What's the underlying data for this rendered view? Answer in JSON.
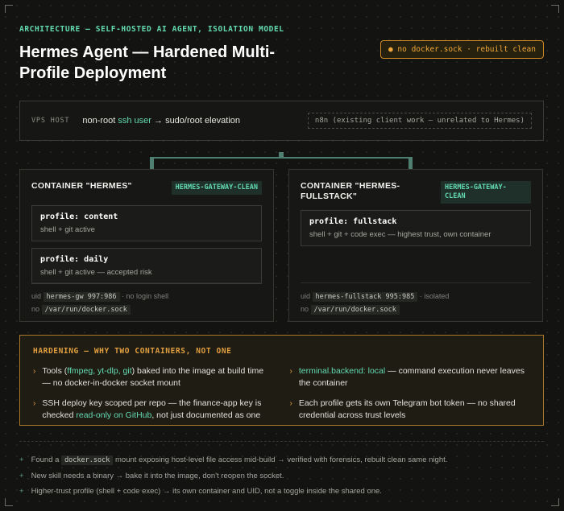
{
  "header": {
    "eyebrow": "ARCHITECTURE — SELF-HOSTED AI AGENT, ISOLATION MODEL",
    "title": "Hermes Agent — Hardened Multi-Profile Deployment",
    "badge": "no docker.sock · rebuilt clean"
  },
  "vps": {
    "label": "VPS HOST",
    "text_prefix": "non-root ",
    "text_highlight": "ssh user",
    "text_suffix": " → sudo/root elevation",
    "n8n": "n8n (existing client work — unrelated to Hermes)"
  },
  "containers": {
    "left": {
      "title": "CONTAINER \"HERMES\"",
      "tag": "HERMES-GATEWAY-CLEAN",
      "profiles": [
        {
          "name": "profile: content",
          "desc": "shell + git active"
        },
        {
          "name": "profile: daily",
          "desc": "shell + git active — accepted risk"
        }
      ],
      "uid_prefix": "uid",
      "uid_code": "hermes-gw 997:986",
      "uid_suffix": "· no login shell",
      "sock_prefix": "no",
      "sock_code": "/var/run/docker.sock"
    },
    "right": {
      "title": "CONTAINER \"HERMES-FULLSTACK\"",
      "tag": "HERMES-GATEWAY-CLEAN",
      "profiles": [
        {
          "name": "profile: fullstack",
          "desc": "shell + git + code exec — highest trust, own container"
        }
      ],
      "uid_prefix": "uid",
      "uid_code": "hermes-fullstack 995:985",
      "uid_suffix": "· isolated",
      "sock_prefix": "no",
      "sock_code": "/var/run/docker.sock"
    }
  },
  "hardening": {
    "title": "HARDENING — WHY TWO CONTAINERS, NOT ONE",
    "item1": {
      "a": "Tools (",
      "hl": "ffmpeg, yt-dlp, git",
      "b": ") baked into the image at build time — no docker-in-docker socket mount"
    },
    "item2": {
      "hl": "terminal.backend: local",
      "b": " — command execution never leaves the container"
    },
    "item3": {
      "a": "SSH deploy key scoped per repo — the finance-app key is checked ",
      "hl": "read-only on GitHub",
      "b": ", not just documented as one"
    },
    "item4": {
      "a": "Each profile gets its own Telegram bot token — no shared credential across trust levels"
    }
  },
  "notes": {
    "note1": {
      "a": "Found a ",
      "code": "docker.sock",
      "b": " mount exposing host-level file access mid-build → verified with forensics, rebuilt clean same night."
    },
    "note2": "New skill needs a binary → bake it into the image, don't reopen the socket.",
    "note3": "Higher-trust profile (shell + code exec) → its own container and UID, not a toggle inside the shared one."
  },
  "colors": {
    "accent_mint": "#63d9b0",
    "accent_amber": "#e2a040",
    "background": "#131412"
  }
}
